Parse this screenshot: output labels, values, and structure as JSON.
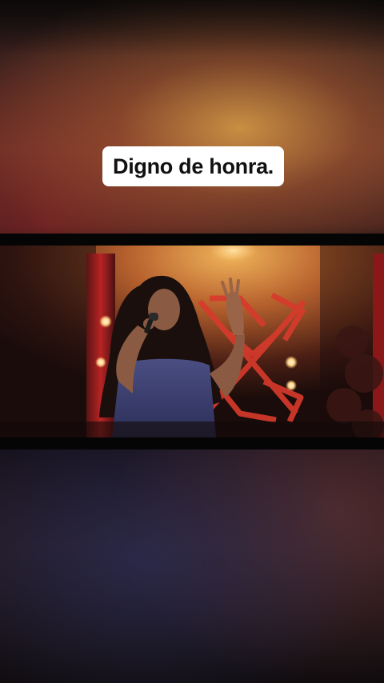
{
  "caption": {
    "text": "Digno de honra."
  },
  "video": {
    "scene": "singer-performing-on-stage"
  },
  "colors": {
    "caption_background": "#ffffff",
    "caption_text": "#111111",
    "letterbox": "#050505",
    "stage_accent": "#d83a2c"
  }
}
